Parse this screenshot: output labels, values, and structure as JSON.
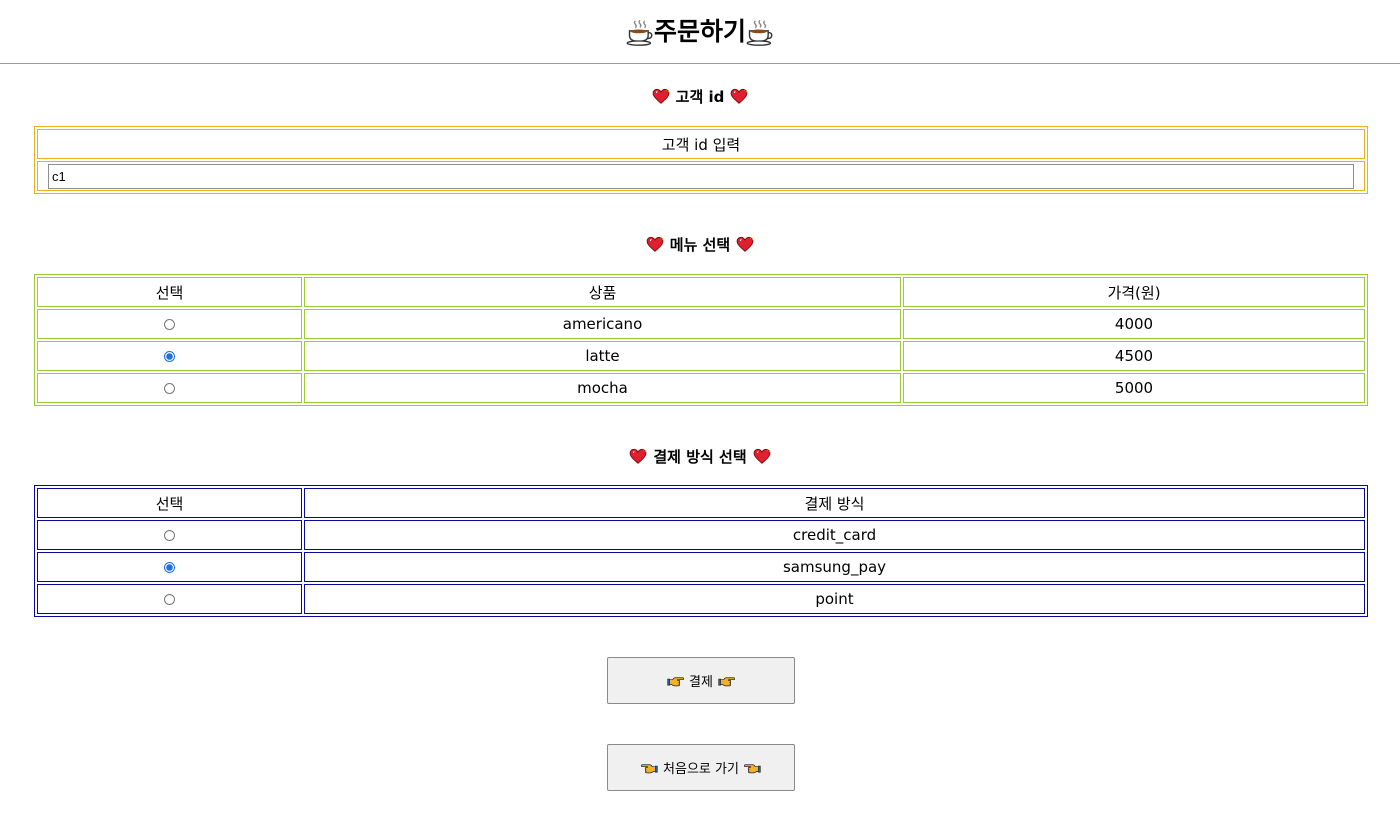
{
  "page": {
    "title": "주문하기"
  },
  "customer": {
    "section_title": "고객 id",
    "header": "고객 id 입력",
    "input_value": "c1"
  },
  "menu": {
    "section_title": "메뉴 선택",
    "headers": [
      "선택",
      "상품",
      "가격(원)"
    ],
    "rows": [
      {
        "name": "americano",
        "price": "4000",
        "selected": false
      },
      {
        "name": "latte",
        "price": "4500",
        "selected": true
      },
      {
        "name": "mocha",
        "price": "5000",
        "selected": false
      }
    ]
  },
  "payment": {
    "section_title": "결제 방식 선택",
    "headers": [
      "선택",
      "결제 방식"
    ],
    "rows": [
      {
        "method": "credit_card",
        "selected": false
      },
      {
        "method": "samsung_pay",
        "selected": true
      },
      {
        "method": "point",
        "selected": false
      }
    ]
  },
  "buttons": {
    "pay_label": "결제",
    "home_label": "처음으로 가기"
  },
  "icons": {
    "title": "hot-beverage-icon",
    "section": "sparkling-heart-icon",
    "pay": "pointing-right-hand-icon",
    "home": "pointing-left-hand-icon"
  },
  "colors": {
    "customer_border": "#e8b21a",
    "menu_border": "#9acd32",
    "payment_border": "#0a0aa0",
    "heart": "#e0202e",
    "radio_checked": "#1f6fe0"
  }
}
